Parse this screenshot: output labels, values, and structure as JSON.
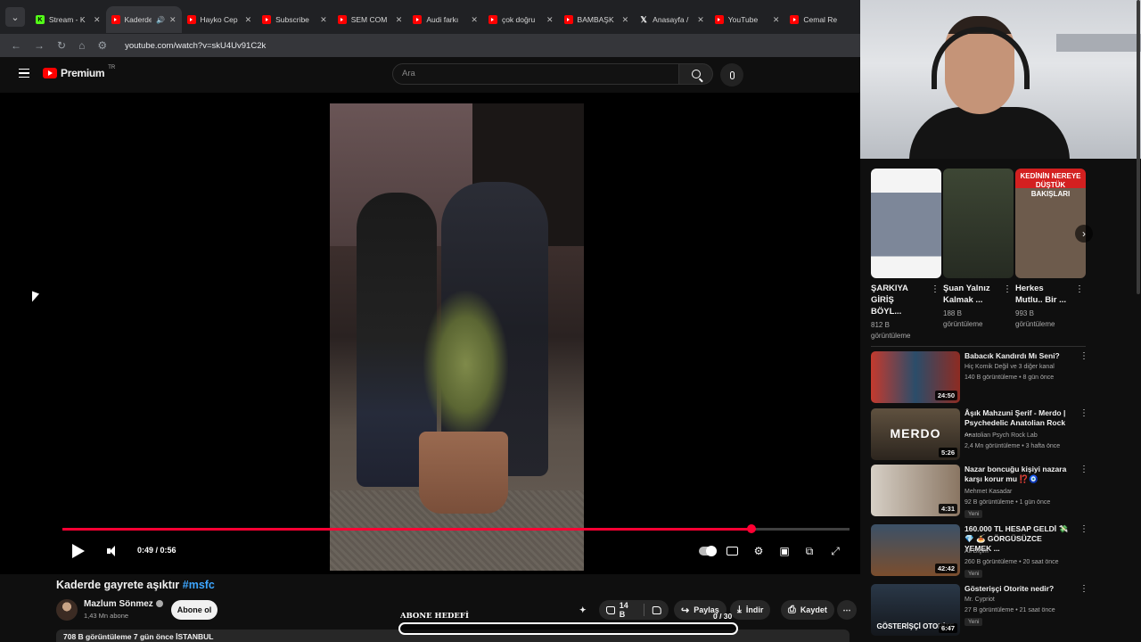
{
  "browser": {
    "tabs": [
      {
        "label": "Stream - K",
        "icon": "kick",
        "active": false
      },
      {
        "label": "Kaderde",
        "icon": "youtube",
        "active": true,
        "playing_audio": true
      },
      {
        "label": "Hayko Cep",
        "icon": "youtube",
        "active": false
      },
      {
        "label": "Subscribe",
        "icon": "youtube",
        "active": false
      },
      {
        "label": "SEM COM",
        "icon": "youtube",
        "active": false
      },
      {
        "label": "Audi farkı",
        "icon": "youtube",
        "active": false
      },
      {
        "label": "çok doğru",
        "icon": "youtube",
        "active": false
      },
      {
        "label": "BAMBAŞK",
        "icon": "youtube",
        "active": false
      },
      {
        "label": "Anasayfa /",
        "icon": "x",
        "active": false
      },
      {
        "label": "YouTube",
        "icon": "youtube",
        "active": false
      },
      {
        "label": "Cemal Re",
        "icon": "youtube",
        "active": false
      }
    ],
    "url": "youtube.com/watch?v=skU4Uv91C2k"
  },
  "youtube": {
    "logo_text": "Premium",
    "logo_region": "TR",
    "search_placeholder": "Ara"
  },
  "player": {
    "time": "0:49 / 0:56",
    "progress": 0.875
  },
  "video": {
    "title": "Kaderde gayrete aşıktır",
    "hashtag": "#msfc",
    "channel": "Mazlum Sönmez",
    "subscribers": "1,43 Mn abone",
    "subscribe_label": "Abone ol",
    "likes": "14 B",
    "share_label": "Paylaş",
    "download_label": "İndir",
    "save_label": "Kaydet",
    "views_line": "708 B görüntüleme  7 gün önce  İSTANBUL"
  },
  "overlay": {
    "goal_label": "ABONE HEDEFİ",
    "goal_count": "0 / 30",
    "goal_progress": 0
  },
  "shorts": [
    {
      "title": "ŞARKIYA GİRİŞ BÖYL...",
      "views": "812 B görüntüleme"
    },
    {
      "title": "Şuan Yalnız Kalmak ...",
      "views": "188 B görüntüleme"
    },
    {
      "title": "Herkes Mutlu.. Bir ...",
      "views": "993 B görüntüleme",
      "thumb_text": "KEDİNİN NEREYE DÜŞTÜK BAKIŞLARI"
    }
  ],
  "recommendations": [
    {
      "title": "Babacık Kandırdı Mı Seni?",
      "channel": "Hiç Komik Değil  ve 3 diğer kanal",
      "meta": "140 B görüntüleme • 8 gün önce",
      "duration": "24:50",
      "badge": ""
    },
    {
      "title": "Âşık Mahzuni Şerif - Merdo | Psychedelic Anatolian Rock ...",
      "channel": "Anatolian Psych Rock Lab",
      "meta": "2,4 Mn görüntüleme • 3 hafta önce",
      "duration": "5:26",
      "badge": "",
      "thumb_text": "MERDO"
    },
    {
      "title": "Nazar boncuğu kişiyi nazara karşı korur mu ⁉️🧿",
      "channel": "Mehmet Kasadar",
      "meta": "92 B görüntüleme • 1 gün önce",
      "duration": "4:31",
      "badge": "Yeni"
    },
    {
      "title": "160.000 TL HESAP GELDİ 💸💎 🍝 GÖRGÜSÜZCE YEMEK ...",
      "channel": "Ali Biçim",
      "meta": "260 B görüntüleme • 20 saat önce",
      "duration": "42:42",
      "badge": "Yeni"
    },
    {
      "title": "Gösterişçi Otorite nedir?",
      "channel": "Mr. Cypriot",
      "meta": "27 B görüntüleme • 21 saat önce",
      "duration": "6:47",
      "badge": "Yeni",
      "thumb_text": "GÖSTERİŞÇİ OTORİTE"
    }
  ],
  "colors": {
    "accent": "#ff0033",
    "background": "#0f0f0f",
    "link": "#3ea6ff"
  }
}
